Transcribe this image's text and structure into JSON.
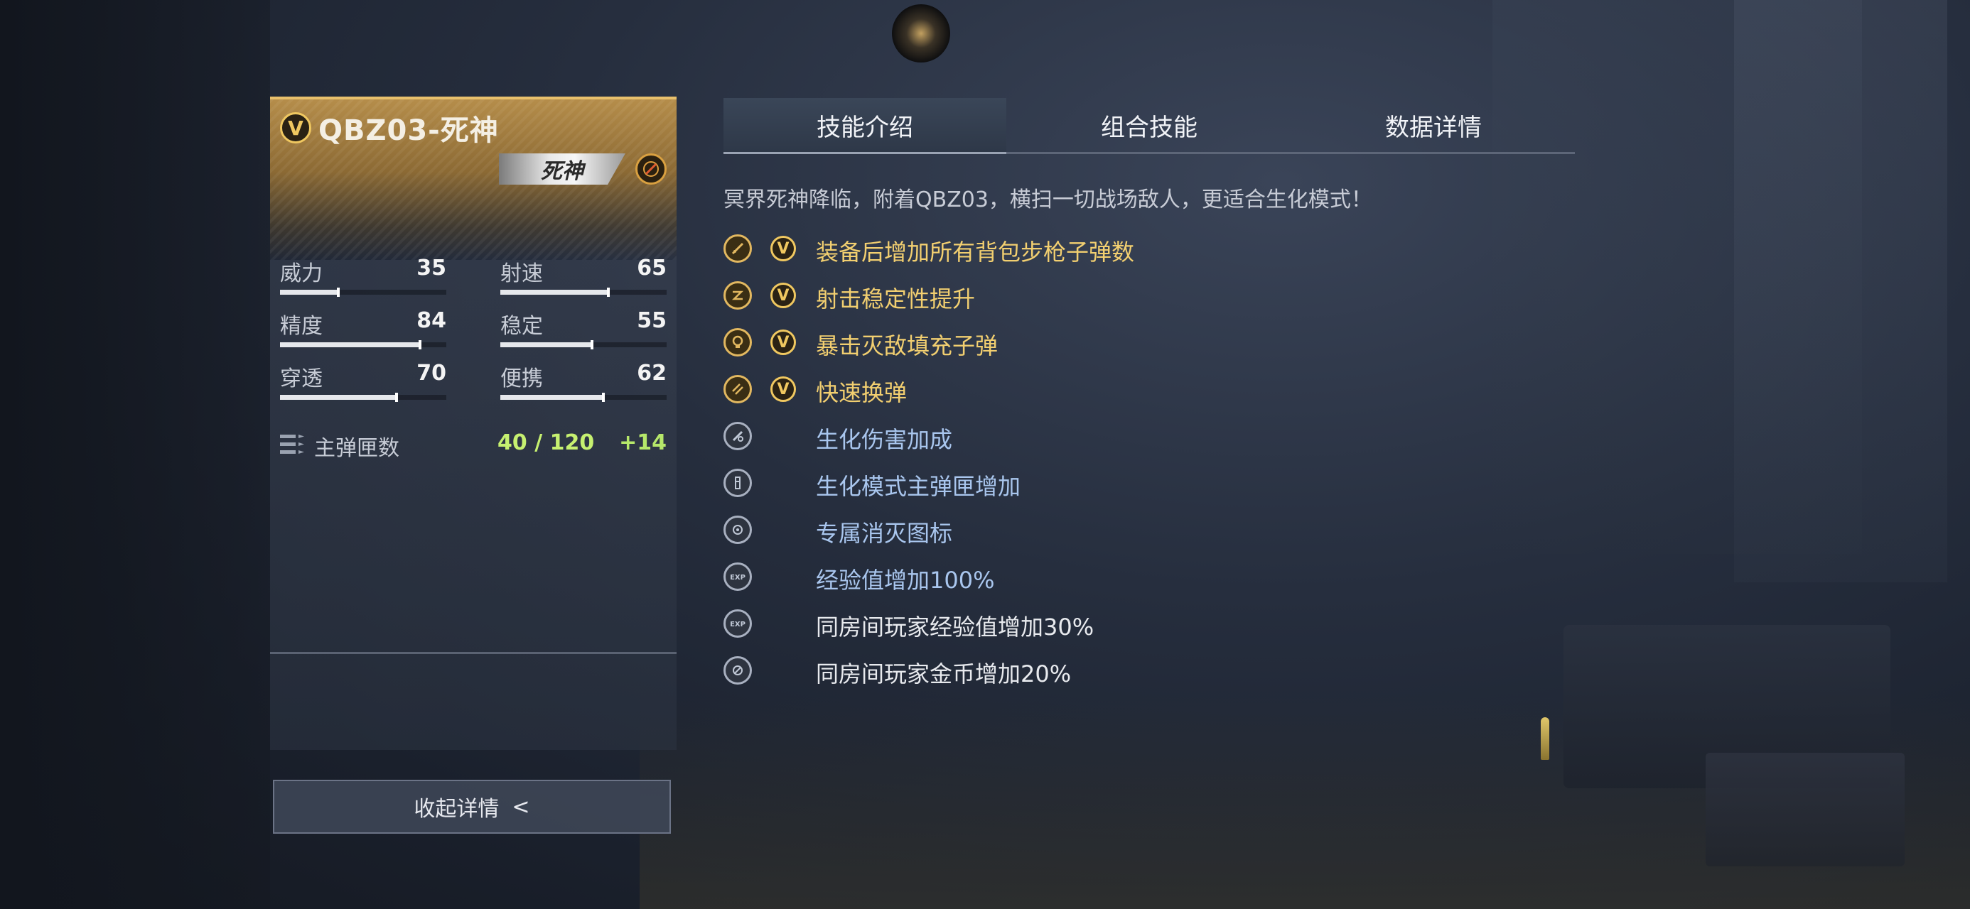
{
  "weapon": {
    "name": "QBZ03-死神",
    "tier_badge": "V",
    "name_tag": "死神"
  },
  "stats": [
    {
      "label": "威力",
      "value": "35",
      "level": 35
    },
    {
      "label": "射速",
      "value": "65",
      "level": 65
    },
    {
      "label": "精度",
      "value": "84",
      "level": 84
    },
    {
      "label": "稳定",
      "value": "55",
      "level": 55
    },
    {
      "label": "穿透",
      "value": "70",
      "level": 70
    },
    {
      "label": "便携",
      "value": "62",
      "level": 62
    }
  ],
  "ammo": {
    "label": "主弹匣数",
    "value": "40 / 120",
    "bonus": "+14"
  },
  "collapse_button": {
    "label": "收起详情",
    "chevron": "<"
  },
  "tabs": [
    {
      "label": "技能介绍",
      "active": true
    },
    {
      "label": "组合技能",
      "active": false
    },
    {
      "label": "数据详情",
      "active": false
    }
  ],
  "description": "冥界死神降临，附着QBZ03，横扫一切战场敌人，更适合生化模式！",
  "skills": [
    {
      "text": "装备后增加所有背包步枪子弹数",
      "icon": "ammo-pouch-icon",
      "tier": "gold",
      "badge": "V"
    },
    {
      "text": "射击稳定性提升",
      "icon": "stability-icon",
      "tier": "gold",
      "badge": "V"
    },
    {
      "text": "暴击灭敌填充子弹",
      "icon": "skull-refill-icon",
      "tier": "gold",
      "badge": "V"
    },
    {
      "text": "快速换弹",
      "icon": "fast-reload-icon",
      "tier": "gold",
      "badge": "V"
    },
    {
      "text": "生化伤害加成",
      "icon": "bio-damage-icon",
      "tier": "silver",
      "badge": ""
    },
    {
      "text": "生化模式主弹匣增加",
      "icon": "bio-magazine-icon",
      "tier": "silver",
      "badge": ""
    },
    {
      "text": "专属消灭图标",
      "icon": "kill-mark-icon",
      "tier": "silver",
      "badge": ""
    },
    {
      "text": "经验值增加100%",
      "icon": "exp-icon",
      "tier": "silver",
      "badge": ""
    },
    {
      "text": "同房间玩家经验值增加30%",
      "icon": "room-exp-icon",
      "tier": "silver",
      "badge": ""
    },
    {
      "text": "同房间玩家金币增加20%",
      "icon": "room-coin-icon",
      "tier": "silver",
      "badge": ""
    }
  ],
  "colors": {
    "gold": "#f2cf70",
    "blue_text": "#a9c6ee",
    "ammo_green": "#c6f070"
  }
}
